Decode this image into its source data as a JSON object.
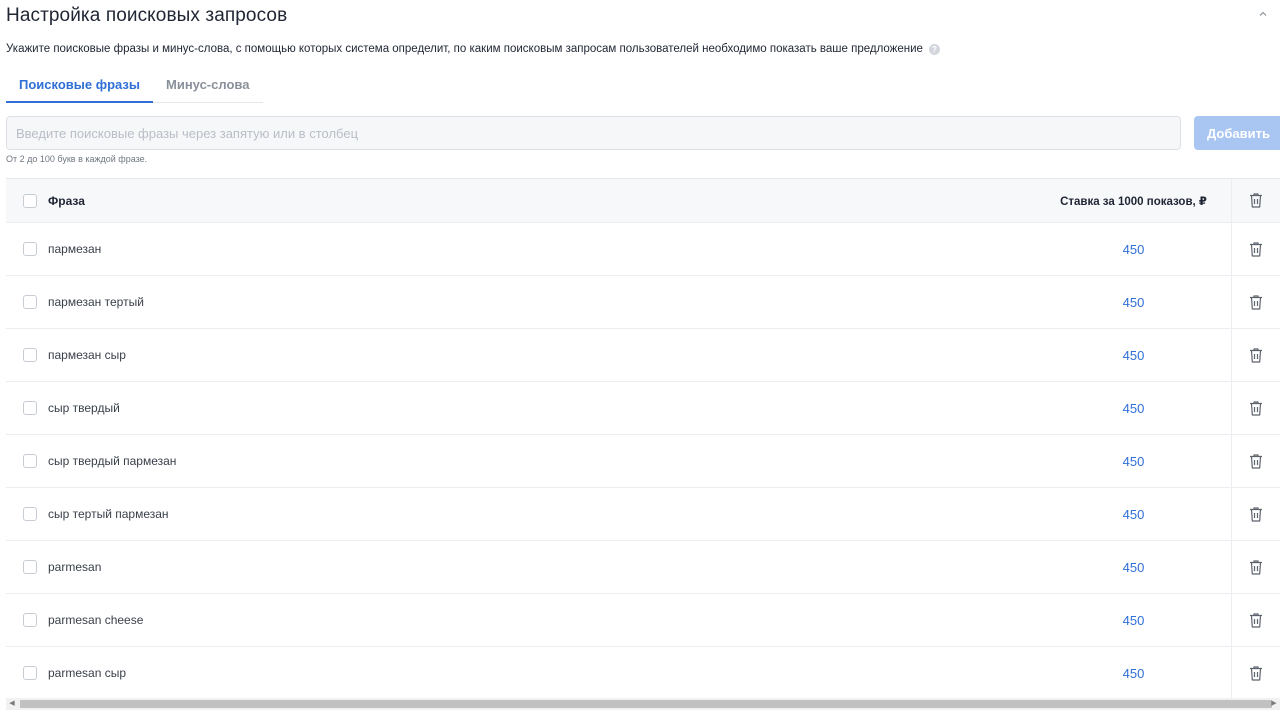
{
  "section": {
    "title": "Настройка поисковых запросов",
    "collapse_icon": "chevron-up-icon",
    "description": "Укажите поисковые фразы и минус-слова, с помощью которых система определит, по каким поисковым запросам пользователей необходимо показать ваше предложение",
    "help_glyph": "?"
  },
  "tabs": [
    {
      "label": "Поисковые фразы",
      "active": true
    },
    {
      "label": "Минус-слова",
      "active": false
    }
  ],
  "input": {
    "placeholder": "Введите поисковые фразы через запятую или в столбец",
    "value": "",
    "hint": "От 2 до 100 букв в каждой фразе."
  },
  "add_button": {
    "label": "Добавить"
  },
  "table": {
    "headers": {
      "phrase": "Фраза",
      "bid": "Ставка за 1000 показов, ₽"
    },
    "rows": [
      {
        "phrase": "пармезан",
        "bid": "450"
      },
      {
        "phrase": "пармезан тертый",
        "bid": "450"
      },
      {
        "phrase": "пармезан сыр",
        "bid": "450"
      },
      {
        "phrase": "сыр твердый",
        "bid": "450"
      },
      {
        "phrase": "сыр твердый пармезан",
        "bid": "450"
      },
      {
        "phrase": "сыр тертый пармезан",
        "bid": "450"
      },
      {
        "phrase": "parmesan",
        "bid": "450"
      },
      {
        "phrase": "parmesan cheese",
        "bid": "450"
      },
      {
        "phrase": "parmesan сыр",
        "bid": "450"
      }
    ]
  },
  "colors": {
    "accent": "#2f6fd6",
    "button_disabled": "#a8c6f1"
  },
  "scrollbar": {
    "left_arrow": "◀",
    "right_arrow": "▶"
  }
}
